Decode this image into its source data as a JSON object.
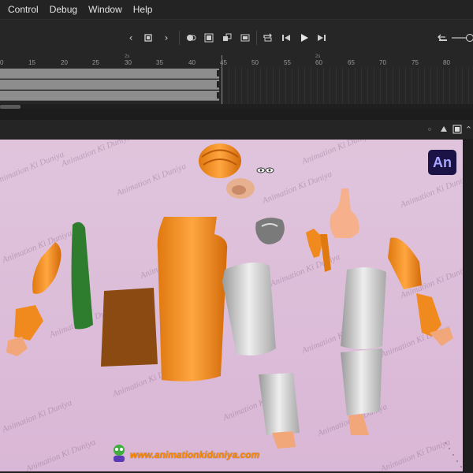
{
  "menubar": {
    "items": [
      "Control",
      "Debug",
      "Window",
      "Help"
    ]
  },
  "toolbar": {
    "icons": [
      "chevron-left-icon",
      "stop-icon",
      "chevron-right-icon",
      "onion-skin-icon",
      "onion-outline-icon",
      "edit-multiple-icon",
      "modify-markers-icon",
      "loop-icon",
      "step-back-icon",
      "play-icon",
      "step-forward-icon",
      "undo-zoom-icon"
    ]
  },
  "ruler": {
    "ticks": [
      "0",
      "15",
      "20",
      "25",
      "30",
      "35",
      "40",
      "45",
      "50",
      "55",
      "60",
      "65",
      "70",
      "75",
      "80"
    ],
    "fps_labels": [
      "2s",
      "2s"
    ]
  },
  "stage": {
    "watermark": "Animation Ki Duniya",
    "logo": "An",
    "site_url": "www.animationkiduniya.com"
  },
  "colors": {
    "accent": "#4b8bff",
    "stage_bg": "#dcbfd9",
    "saffron": "#f08a1e",
    "skin": "#f2a77a",
    "green": "#2e7d2e",
    "brown": "#8b4a12",
    "dhoti_grey": "#cfcfcf"
  }
}
